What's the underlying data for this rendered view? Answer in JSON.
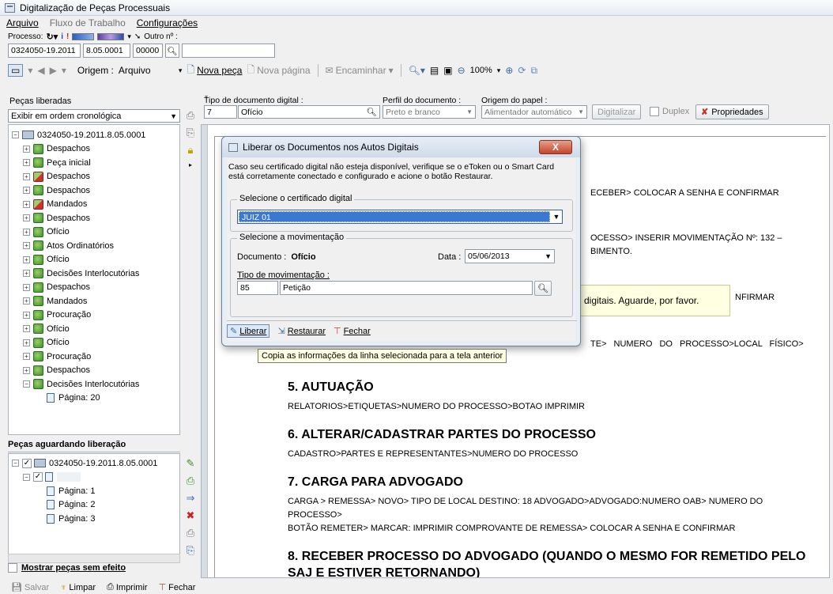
{
  "window": {
    "title": "Digitalização de Peças Processuais"
  },
  "menu": {
    "items": [
      "Arquivo",
      "Fluxo de Trabalho",
      "Configurações"
    ]
  },
  "process": {
    "label": "Processo:",
    "other_label": "Outro nº :",
    "number_part1": "0324050-19.2011",
    "number_part2": "8.05.0001",
    "number_part3": "00000"
  },
  "toolbar": {
    "origem_label": "Origem :",
    "origem_value": "Arquivo",
    "nova_peca": "Nova peça",
    "nova_pagina": "Nova página",
    "encaminhar": "Encaminhar",
    "zoom": "100%"
  },
  "left_panel": {
    "title": "Peças liberadas",
    "order_select": "Exibir em ordem cronológica",
    "tree_root": "0324050-19.2011.8.05.0001",
    "tree_items": [
      {
        "label": "Despachos",
        "icon": "green"
      },
      {
        "label": "Peça inicial",
        "icon": "green"
      },
      {
        "label": "Despachos",
        "icon": "red"
      },
      {
        "label": "Despachos",
        "icon": "green"
      },
      {
        "label": "Mandados",
        "icon": "red"
      },
      {
        "label": "Despachos",
        "icon": "green"
      },
      {
        "label": "Ofício",
        "icon": "green"
      },
      {
        "label": "Atos Ordinatórios",
        "icon": "green"
      },
      {
        "label": "Ofício",
        "icon": "green"
      },
      {
        "label": "Decisões Interlocutórias",
        "icon": "green"
      },
      {
        "label": "Despachos",
        "icon": "green"
      },
      {
        "label": "Mandados",
        "icon": "green"
      },
      {
        "label": "Procuração",
        "icon": "green"
      },
      {
        "label": "Ofício",
        "icon": "green"
      },
      {
        "label": "Ofício",
        "icon": "green"
      },
      {
        "label": "Procuração",
        "icon": "green"
      },
      {
        "label": "Despachos",
        "icon": "green"
      },
      {
        "label": "Decisões Interlocutórias",
        "icon": "green"
      }
    ],
    "page_child": "Página: 20"
  },
  "waiting_panel": {
    "title": "Peças aguardando liberação",
    "root": "0324050-19.2011.8.05.0001",
    "pages": [
      "Página: 1",
      "Página: 2",
      "Página: 3"
    ],
    "show_without_effect": "Mostrar peças sem efeito"
  },
  "doc_type": {
    "label": "Tipo de documento digital :",
    "code": "7",
    "name": "Ofício",
    "profile_label": "Perfil do documento :",
    "profile_value": "Preto e branco",
    "paper_origin_label": "Origem do papel :",
    "paper_origin_value": "Alimentador automático",
    "digitalizar": "Digitalizar",
    "duplex": "Duplex",
    "propriedades": "Propriedades"
  },
  "document": {
    "frag1": "ECEBER> COLOCAR A SENHA E CONFIRMAR",
    "frag2a": "OCESSO> INSERIR MOVIMENTAÇÃO Nº: 132 –",
    "frag2b": "BIMENTO.",
    "frag3": "NFIRMAR",
    "overlay_msg": "digitais. Aguarde, por favor.",
    "frag4": "TE> NUMERO DO PROCESSO>LOCAL FÍSICO>",
    "sections": [
      {
        "title": "5. AUTUAÇÃO",
        "lines": [
          "RELATORIOS>ETIQUETAS>NUMERO DO PROCESSO>BOTAO IMPRIMIR"
        ]
      },
      {
        "title": "6. ALTERAR/CADASTRAR PARTES DO PROCESSO",
        "lines": [
          "CADASTRO>PARTES E REPRESENTANTES>NUMERO DO PROCESSO"
        ]
      },
      {
        "title": "7. CARGA PARA ADVOGADO",
        "lines": [
          "CARGA > REMESSA> NOVO> TIPO DE LOCAL DESTINO: 18 ADVOGADO>ADVOGADO:NUMERO OAB> NUMERO DO PROCESSO>",
          "BOTÃO REMETER> MARCAR: IMPRIMIR COMPROVANTE DE REMESSA> COLOCAR A SENHA E CONFIRMAR"
        ]
      },
      {
        "title": "8. RECEBER PROCESSO DO ADVOGADO (QUANDO O MESMO FOR REMETIDO PELO SAJ E ESTIVER RETORNANDO)",
        "lines": []
      }
    ]
  },
  "dialog": {
    "title": "Liberar os Documentos nos Autos Digitais",
    "info": "Caso seu certificado digital não esteja disponível, verifique se o eToken ou o Smart Card está corretamente conectado e configurado e acione o botão Restaurar.",
    "cert_group": "Selecione o certificado digital",
    "cert_value": "JUIZ 01",
    "mov_group": "Selecione a movimentação",
    "documento_label": "Documento :",
    "documento_value": "Ofício",
    "data_label": "Data :",
    "data_value": "05/06/2013",
    "tipo_mov_label": "Tipo de movimentação :",
    "tipo_mov_code": "85",
    "tipo_mov_name": "Petição",
    "liberar": "Liberar",
    "restaurar": "Restaurar",
    "fechar": "Fechar",
    "tooltip": "Copia as informações da linha selecionada para a tela anterior"
  },
  "statusbar": {
    "salvar": "Salvar",
    "limpar": "Limpar",
    "imprimir": "Imprimir",
    "fechar": "Fechar"
  }
}
